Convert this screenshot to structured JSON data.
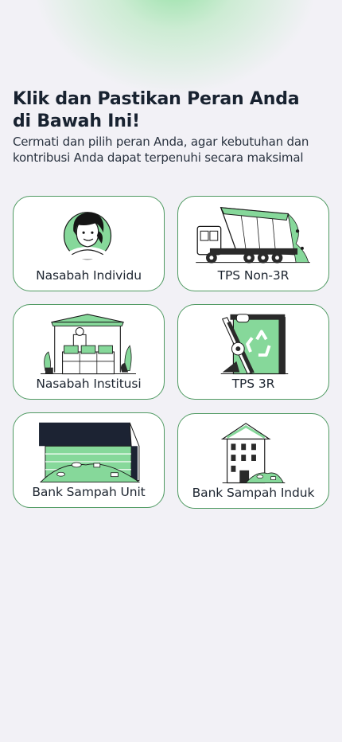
{
  "header": {
    "title_line1": "Klik dan Pastikan Peran Anda",
    "title_line2": "di Bawah Ini!",
    "subtitle_line1": "Cermati dan pilih peran Anda, agar kebutuhan dan",
    "subtitle_line2": "kontribusi Anda dapat terpenuhi secara maksimal"
  },
  "roles": [
    {
      "label": "Nasabah Individu",
      "icon": "person-avatar-icon"
    },
    {
      "label": "TPS Non-3R",
      "icon": "dump-truck-icon"
    },
    {
      "label": "Nasabah Institusi",
      "icon": "market-stall-icon"
    },
    {
      "label": "TPS 3R",
      "icon": "recycle-bin-conveyor-icon"
    },
    {
      "label": "Bank Sampah Unit",
      "icon": "warehouse-waste-icon"
    },
    {
      "label": "Bank Sampah Induk",
      "icon": "building-waste-icon"
    }
  ],
  "colors": {
    "accent": "#4f9a62",
    "illustration_green": "#86d89a",
    "background": "#f2f1f6"
  }
}
